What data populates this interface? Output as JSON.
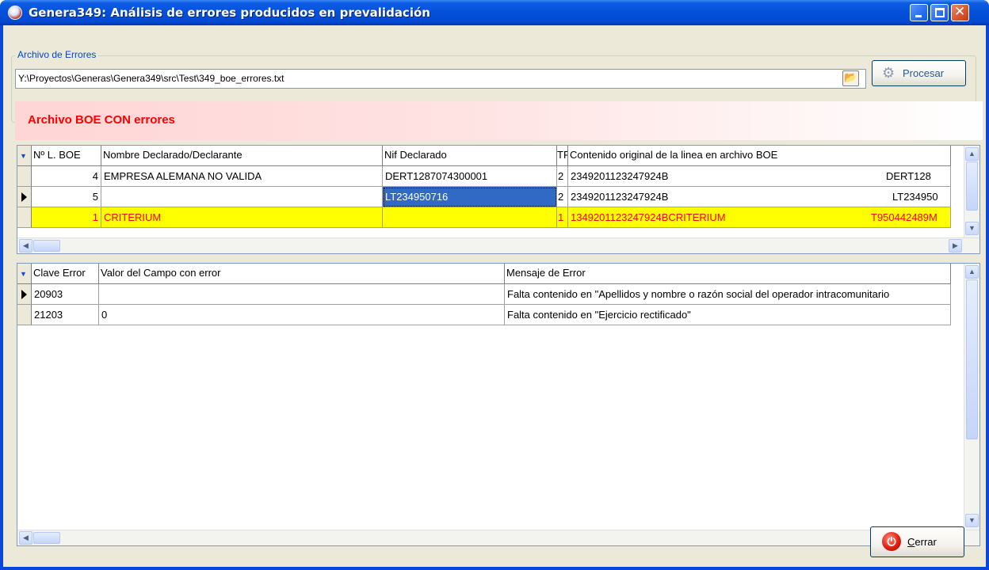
{
  "window": {
    "title": "Genera349: Análisis de errores producidos en prevalidación"
  },
  "file_group": {
    "legend": "Archivo de Errores",
    "path_value": "Y:\\Proyectos\\Generas\\Genera349\\src\\Test\\349_boe_errores.txt",
    "browse_icon": "folder-open-icon",
    "process_label": "Procesar",
    "process_icon": "gears-icon"
  },
  "banner": {
    "text": "Archivo BOE CON errores",
    "color": "#ff0000"
  },
  "records_grid": {
    "columns": [
      "Nº L. BOE",
      "Nombre Declarado/Declarante",
      "Nif Declarado",
      "TR",
      "Contenido original de la linea en archivo BOE"
    ],
    "rows": [
      {
        "line": "4",
        "name": "EMPRESA ALEMANA NO VALIDA",
        "nif": "DERT1287074300001",
        "tr": "2",
        "content": "2349201123247924B",
        "content_tail": "DERT128",
        "highlight": false,
        "current": false
      },
      {
        "line": "5",
        "name": "",
        "nif": "LT234950716",
        "tr": "2",
        "content": "2349201123247924B",
        "content_tail": "LT234950",
        "highlight": false,
        "current": true
      },
      {
        "line": "1",
        "name": "CRITERIUM",
        "nif": "",
        "tr": "1",
        "content": "1349201123247924BCRITERIUM",
        "content_tail": "T950442489M",
        "highlight": true,
        "current": false
      }
    ],
    "highlight_color": "#ffff00",
    "highlight_text_color": "#ff0000"
  },
  "errors_grid": {
    "columns": [
      "Clave Error",
      "Valor del Campo con error",
      "Mensaje de Error"
    ],
    "rows": [
      {
        "code": "20903",
        "value": "",
        "message": "Falta contenido en \"Apellidos y nombre o razón social del operador intracomunitario",
        "current": true
      },
      {
        "code": "21203",
        "value": "0",
        "message": "Falta contenido en \"Ejercicio rectificado\"",
        "current": false
      }
    ]
  },
  "footer": {
    "close_label": "Cerrar",
    "close_icon": "power-icon"
  }
}
